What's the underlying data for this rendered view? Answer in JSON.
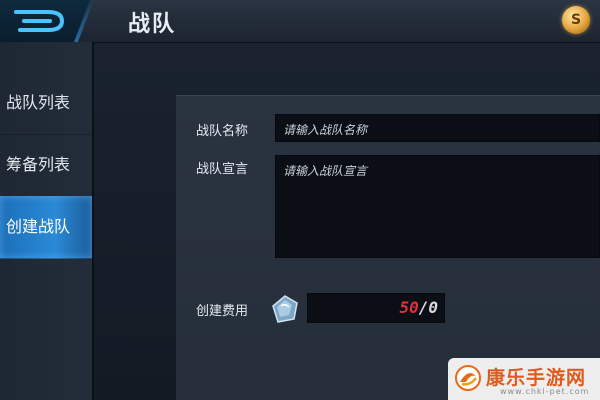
{
  "header": {
    "title": "战队"
  },
  "sidebar": {
    "items": [
      {
        "label": "战队列表"
      },
      {
        "label": "筹备列表"
      },
      {
        "label": "创建战队"
      }
    ]
  },
  "form": {
    "name_label": "战队名称",
    "name_placeholder": "请输入战队名称",
    "declaration_label": "战队宣言",
    "declaration_placeholder": "请输入战队宣言",
    "cost_label": "创建费用",
    "cost_current": "50",
    "cost_slash": "/",
    "cost_owned": "0"
  },
  "watermark": {
    "title": "康乐手游网",
    "url": "www.chkl-pet.com"
  },
  "colors": {
    "accent": "#2a8ad8",
    "cost_insufficient": "#e0303a"
  }
}
